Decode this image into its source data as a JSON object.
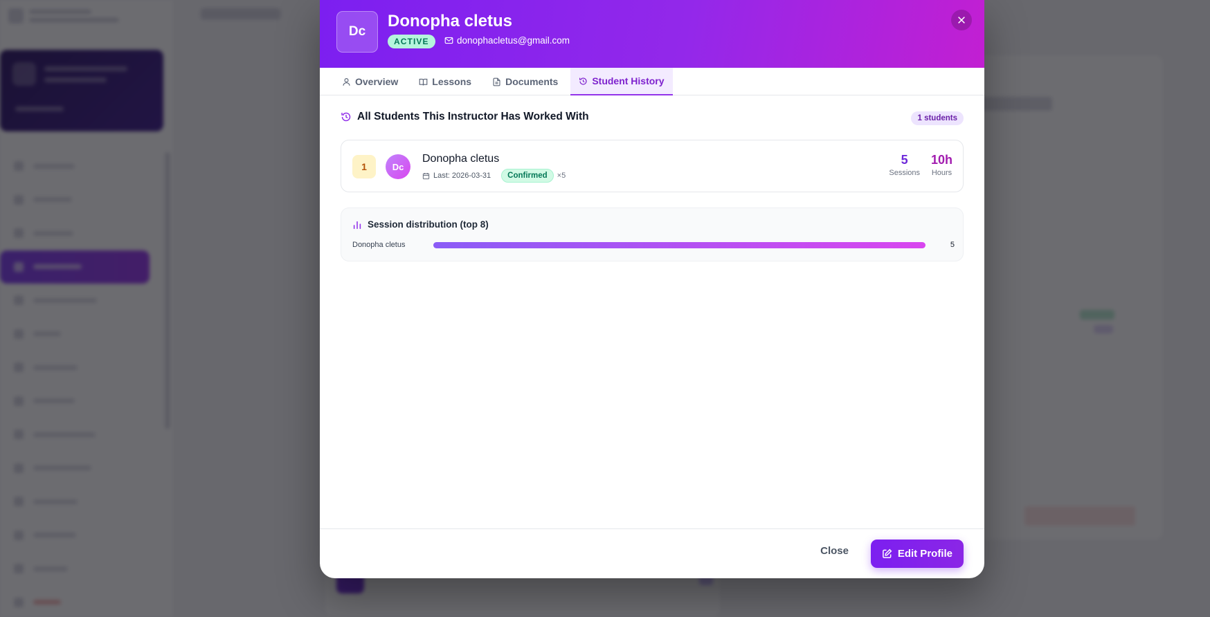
{
  "modal": {
    "avatar_initials": "Dc",
    "name": "Donopha cletus",
    "status": "ACTIVE",
    "email": "donophacletus@gmail.com"
  },
  "tabs": [
    {
      "label": "Overview",
      "icon": "user-icon",
      "active": false
    },
    {
      "label": "Lessons",
      "icon": "book-icon",
      "active": false
    },
    {
      "label": "Documents",
      "icon": "document-icon",
      "active": false
    },
    {
      "label": "Student History",
      "icon": "history-icon",
      "active": true
    }
  ],
  "history": {
    "title": "All Students This Instructor Has Worked With",
    "count_label": "1 students",
    "students": [
      {
        "rank": "1",
        "initials": "Dc",
        "name": "Donopha cletus",
        "last": "Last: 2026-03-31",
        "status": "Confirmed",
        "multiplier": "×5",
        "sessions_value": "5",
        "sessions_label": "Sessions",
        "hours_value": "10h",
        "hours_label": "Hours"
      }
    ]
  },
  "distribution": {
    "title": "Session distribution (top 8)",
    "max": 5,
    "rows": [
      {
        "label": "Donopha cletus",
        "value": 5
      }
    ]
  },
  "footer": {
    "close_label": "Close",
    "edit_label": "Edit Profile"
  },
  "colors": {
    "accent": "#7c1ff0",
    "accent_end": "#c21fd2",
    "active_badge_bg": "#b5f5dc",
    "confirmed_bg": "#d1fae5"
  }
}
